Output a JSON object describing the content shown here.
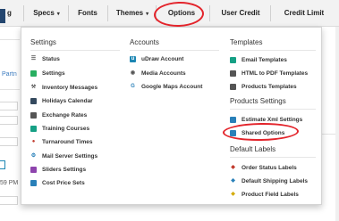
{
  "colors": {
    "nav_bg": "#f2f2f2",
    "accent": "#1c86b3",
    "highlight_ring": "#e3242b",
    "icon_dark": "#555555",
    "icon_green": "#27ae60",
    "icon_orange": "#e67e22",
    "icon_blue": "#2980b9",
    "icon_red": "#c0392b",
    "icon_yellow": "#d4ac0d",
    "icon_teal": "#16a085",
    "icon_purple": "#8e44ad",
    "icon_navy": "#34495e"
  },
  "navbar": {
    "items": [
      {
        "label": "g",
        "dropdown": false
      },
      {
        "label": "Specs",
        "dropdown": true
      },
      {
        "label": "Fonts",
        "dropdown": false
      },
      {
        "label": "Themes",
        "dropdown": true
      },
      {
        "label": "Options",
        "dropdown": false
      },
      {
        "label": "User Credit",
        "dropdown": false
      },
      {
        "label": "Credit Limit",
        "dropdown": false
      }
    ]
  },
  "underlay": {
    "fragment_partner": "Partn",
    "fragment_time": "59 PM"
  },
  "menu": {
    "settings": {
      "title": "Settings",
      "items": [
        {
          "label": "Status",
          "icon": "list-icon"
        },
        {
          "label": "Settings",
          "icon": "gear-icon"
        },
        {
          "label": "Inventory Messages",
          "icon": "wrench-icon"
        },
        {
          "label": "Holidays Calendar",
          "icon": "calendar-icon"
        },
        {
          "label": "Exchange Rates",
          "icon": "money-icon"
        },
        {
          "label": "Training Courses",
          "icon": "film-icon"
        },
        {
          "label": "Turnaround Times",
          "icon": "clock-icon"
        },
        {
          "label": "Mail Server Settings",
          "icon": "cog-icon"
        },
        {
          "label": "Sliders Settings",
          "icon": "sliders-icon"
        },
        {
          "label": "Cost Price Sets",
          "icon": "price-icon"
        }
      ]
    },
    "accounts": {
      "title": "Accounts",
      "items": [
        {
          "label": "uDraw Account",
          "icon": "udraw-icon"
        },
        {
          "label": "Media Accounts",
          "icon": "media-icon"
        },
        {
          "label": "Google Maps Account",
          "icon": "google-icon"
        }
      ]
    },
    "templates": {
      "title": "Templates",
      "items": [
        {
          "label": "Email Templates",
          "icon": "email-icon"
        },
        {
          "label": "HTML to PDF Templates",
          "icon": "pdf-icon"
        },
        {
          "label": "Products Templates",
          "icon": "product-icon"
        }
      ]
    },
    "products_settings": {
      "title": "Products Settings",
      "items": [
        {
          "label": "Estimate Xml Settings",
          "icon": "xml-icon"
        },
        {
          "label": "Shared Options",
          "icon": "shared-icon"
        }
      ]
    },
    "default_labels": {
      "title": "Default Labels",
      "items": [
        {
          "label": "Order Status Labels",
          "icon": "tag-icon"
        },
        {
          "label": "Default Shipping Labels",
          "icon": "shipping-icon"
        },
        {
          "label": "Product Field Labels",
          "icon": "field-icon"
        }
      ]
    }
  }
}
